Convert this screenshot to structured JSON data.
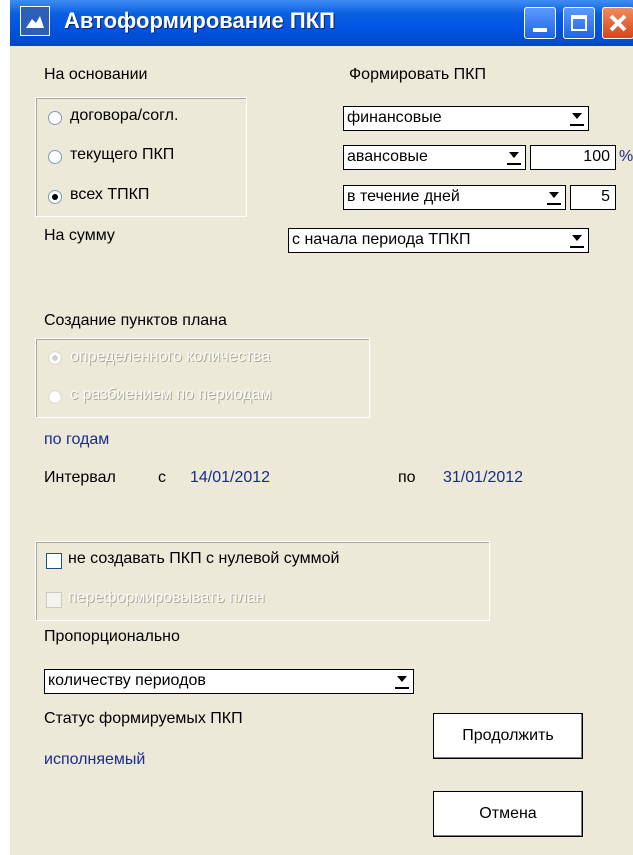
{
  "window": {
    "title": "Автоформирование ПКП"
  },
  "basis": {
    "heading": "На основании",
    "options": [
      "договора/согл.",
      "текущего ПКП",
      "всех ТПКП"
    ],
    "selected_index": 2
  },
  "form": {
    "heading": "Формировать ПКП",
    "type_value": "финансовые",
    "kind_value": "авансовые",
    "percent_value": "100",
    "percent_unit": "%",
    "period_value": "в течение дней",
    "days_value": "5"
  },
  "sum": {
    "label": "На сумму",
    "value": "с начала периода ТПКП"
  },
  "plan": {
    "heading": "Создание пунктов плана",
    "options": [
      "определенного количества",
      "с разбиением по периодам"
    ],
    "period_text": "по годам"
  },
  "interval": {
    "label": "Интервал",
    "from_label": "с",
    "from_value": "14/01/2012",
    "to_label": "по",
    "to_value": "31/01/2012"
  },
  "options": {
    "no_zero_label": "не создавать ПКП с нулевой суммой",
    "reform_label": "переформировывать план"
  },
  "proportional": {
    "label": "Пропорционально",
    "value": "количеству периодов"
  },
  "status": {
    "label": "Статус формируемых ПКП",
    "value": "исполняемый"
  },
  "buttons": {
    "continue_label": "Продолжить",
    "cancel_label": "Отмена"
  },
  "colors": {
    "titlebar": "#0054e3",
    "face": "#ece9d8",
    "value_text": "#1c2a8c"
  }
}
